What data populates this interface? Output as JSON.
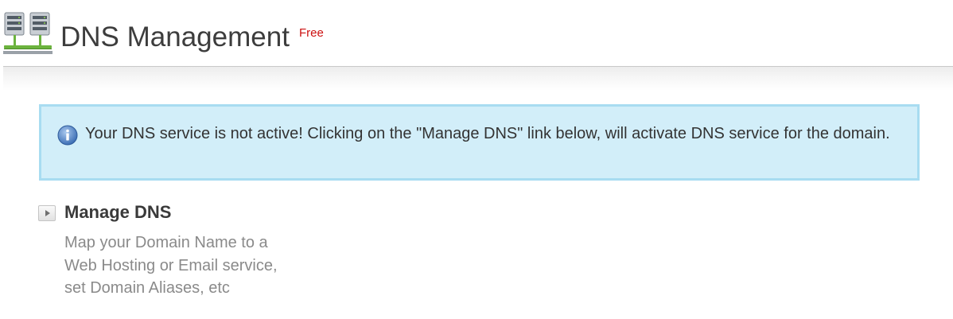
{
  "header": {
    "title": "DNS Management",
    "badge": "Free",
    "icon": "dns-servers-icon"
  },
  "alert": {
    "icon": "info-icon",
    "message": "Your DNS service is not active! Clicking on the \"Manage DNS\" link below, will activate DNS service for the domain."
  },
  "manage_dns": {
    "title": "Manage DNS",
    "icon": "play-arrow-icon",
    "description_lines": [
      "Map your Domain Name to a",
      "Web Hosting or Email service,",
      "set Domain Aliases, etc"
    ]
  },
  "colors": {
    "alert_background": "#d2eef9",
    "alert_border": "#a8dcf1",
    "badge_red": "#cc1111",
    "title_text": "#3d3d3d",
    "description_text": "#8a8a8a"
  }
}
